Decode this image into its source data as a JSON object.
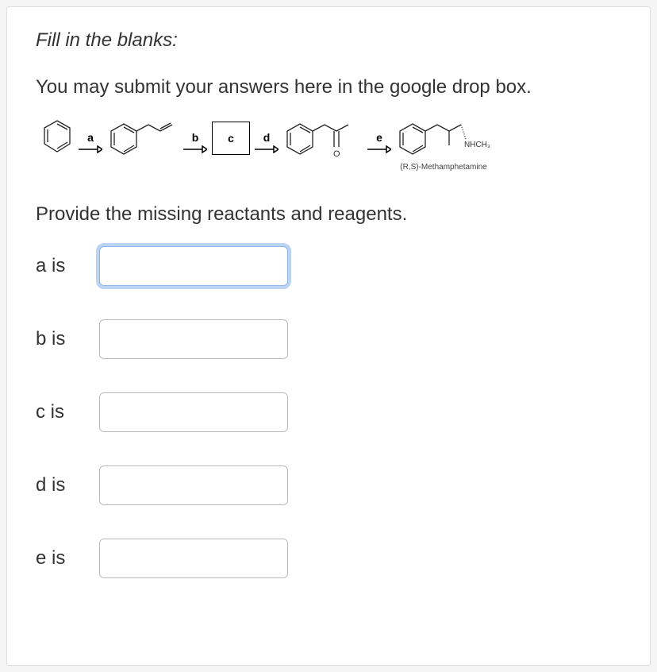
{
  "instruction": "Fill in the blanks:",
  "description": "You may submit your answers here in the google drop box.",
  "prompt": "Provide the missing reactants and reagents.",
  "scheme": {
    "step_a": "a",
    "step_b": "b",
    "step_c": "c",
    "step_d": "d",
    "step_e": "e",
    "o_label": "O",
    "nhch3": "NHCH₃",
    "product_name": "(R,S)-Methamphetamine"
  },
  "answers": [
    {
      "label": "a is",
      "value": "",
      "focused": true
    },
    {
      "label": "b is",
      "value": "",
      "focused": false
    },
    {
      "label": "c is",
      "value": "",
      "focused": false
    },
    {
      "label": "d is",
      "value": "",
      "focused": false
    },
    {
      "label": "e is",
      "value": "",
      "focused": false
    }
  ]
}
